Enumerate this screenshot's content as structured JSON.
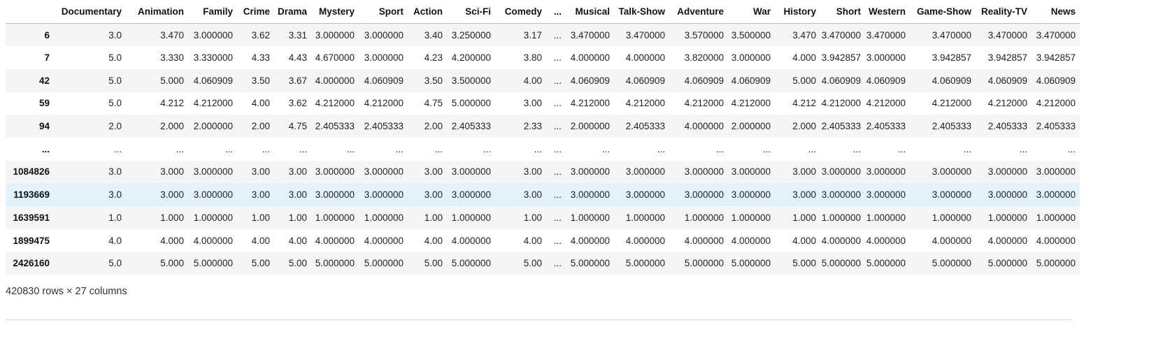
{
  "table": {
    "columns": [
      "",
      "Documentary",
      "Animation",
      "Family",
      "Crime",
      "Drama",
      "Mystery",
      "Sport",
      "Action",
      "Sci-Fi",
      "Comedy",
      "...",
      "Musical",
      "Talk-Show",
      "Adventure",
      "War",
      "History",
      "Short",
      "Western",
      "Game-Show",
      "Reality-TV",
      "News"
    ],
    "highlight_row": 7,
    "rows": [
      [
        "6",
        "3.0",
        "3.470",
        "3.000000",
        "3.62",
        "3.31",
        "3.000000",
        "3.000000",
        "3.40",
        "3.250000",
        "3.17",
        "...",
        "3.470000",
        "3.470000",
        "3.570000",
        "3.500000",
        "3.470",
        "3.470000",
        "3.470000",
        "3.470000",
        "3.470000",
        "3.470000"
      ],
      [
        "7",
        "5.0",
        "3.330",
        "3.330000",
        "4.33",
        "4.43",
        "4.670000",
        "3.000000",
        "4.23",
        "4.200000",
        "3.80",
        "...",
        "4.000000",
        "4.000000",
        "3.820000",
        "3.000000",
        "4.000",
        "3.942857",
        "3.000000",
        "3.942857",
        "3.942857",
        "3.942857"
      ],
      [
        "42",
        "5.0",
        "5.000",
        "4.060909",
        "3.50",
        "3.67",
        "4.000000",
        "4.060909",
        "3.50",
        "3.500000",
        "4.00",
        "...",
        "4.060909",
        "4.060909",
        "4.060909",
        "4.060909",
        "5.000",
        "4.060909",
        "4.060909",
        "4.060909",
        "4.060909",
        "4.060909"
      ],
      [
        "59",
        "5.0",
        "4.212",
        "4.212000",
        "4.00",
        "3.62",
        "4.212000",
        "4.212000",
        "4.75",
        "5.000000",
        "3.00",
        "...",
        "4.212000",
        "4.212000",
        "4.212000",
        "4.212000",
        "4.212",
        "4.212000",
        "4.212000",
        "4.212000",
        "4.212000",
        "4.212000"
      ],
      [
        "94",
        "2.0",
        "2.000",
        "2.000000",
        "2.00",
        "4.75",
        "2.405333",
        "2.405333",
        "2.00",
        "2.405333",
        "2.33",
        "...",
        "2.000000",
        "2.405333",
        "4.000000",
        "2.000000",
        "2.000",
        "2.405333",
        "2.405333",
        "2.405333",
        "2.405333",
        "2.405333"
      ],
      [
        "...",
        "...",
        "...",
        "...",
        "...",
        "...",
        "...",
        "...",
        "...",
        "...",
        "...",
        "...",
        "...",
        "...",
        "...",
        "...",
        "...",
        "...",
        "...",
        "...",
        "...",
        "..."
      ],
      [
        "1084826",
        "3.0",
        "3.000",
        "3.000000",
        "3.00",
        "3.00",
        "3.000000",
        "3.000000",
        "3.00",
        "3.000000",
        "3.00",
        "...",
        "3.000000",
        "3.000000",
        "3.000000",
        "3.000000",
        "3.000",
        "3.000000",
        "3.000000",
        "3.000000",
        "3.000000",
        "3.000000"
      ],
      [
        "1193669",
        "3.0",
        "3.000",
        "3.000000",
        "3.00",
        "3.00",
        "3.000000",
        "3.000000",
        "3.00",
        "3.000000",
        "3.00",
        "...",
        "3.000000",
        "3.000000",
        "3.000000",
        "3.000000",
        "3.000",
        "3.000000",
        "3.000000",
        "3.000000",
        "3.000000",
        "3.000000"
      ],
      [
        "1639591",
        "1.0",
        "1.000",
        "1.000000",
        "1.00",
        "1.00",
        "1.000000",
        "1.000000",
        "1.00",
        "1.000000",
        "1.00",
        "...",
        "1.000000",
        "1.000000",
        "1.000000",
        "1.000000",
        "1.000",
        "1.000000",
        "1.000000",
        "1.000000",
        "1.000000",
        "1.000000"
      ],
      [
        "1899475",
        "4.0",
        "4.000",
        "4.000000",
        "4.00",
        "4.00",
        "4.000000",
        "4.000000",
        "4.00",
        "4.000000",
        "4.00",
        "...",
        "4.000000",
        "4.000000",
        "4.000000",
        "4.000000",
        "4.000",
        "4.000000",
        "4.000000",
        "4.000000",
        "4.000000",
        "4.000000"
      ],
      [
        "2426160",
        "5.0",
        "5.000",
        "5.000000",
        "5.00",
        "5.00",
        "5.000000",
        "5.000000",
        "5.00",
        "5.000000",
        "5.00",
        "...",
        "5.000000",
        "5.000000",
        "5.000000",
        "5.000000",
        "5.000",
        "5.000000",
        "5.000000",
        "5.000000",
        "5.000000",
        "5.000000"
      ]
    ]
  },
  "footer": {
    "shape_text": "420830 rows × 27 columns"
  }
}
